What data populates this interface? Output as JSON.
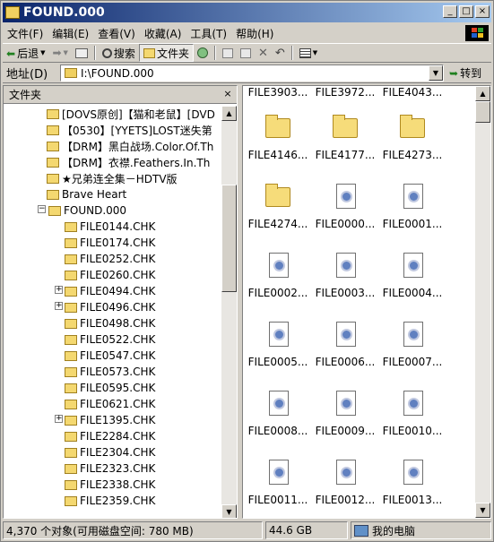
{
  "window": {
    "title": "FOUND.000",
    "min": "_",
    "max": "□",
    "close": "×"
  },
  "menu": [
    "文件(F)",
    "编辑(E)",
    "查看(V)",
    "收藏(A)",
    "工具(T)",
    "帮助(H)"
  ],
  "toolbar": {
    "back": "后退",
    "search": "搜索",
    "folders": "文件夹"
  },
  "address": {
    "label": "地址(D)",
    "value": "I:\\FOUND.000",
    "go": "转到"
  },
  "leftpane": {
    "title": "文件夹",
    "close": "×",
    "items": [
      "[DOVS原创]【猫和老鼠】[DVD",
      "【0530】[YYETS]LOST迷失第",
      "【DRM】黑白战场.Color.Of.Th",
      "【DRM】衣襟.Feathers.In.Th",
      "★兄弟连全集－HDTV版",
      "Brave Heart",
      "FOUND.000",
      "FILE0144.CHK",
      "FILE0174.CHK",
      "FILE0252.CHK",
      "FILE0260.CHK",
      "FILE0494.CHK",
      "FILE0496.CHK",
      "FILE0498.CHK",
      "FILE0522.CHK",
      "FILE0547.CHK",
      "FILE0573.CHK",
      "FILE0595.CHK",
      "FILE0621.CHK",
      "FILE1395.CHK",
      "FILE2284.CHK",
      "FILE2304.CHK",
      "FILE2323.CHK",
      "FILE2338.CHK",
      "FILE2359.CHK"
    ]
  },
  "rightpane": {
    "partial": [
      "FILE3903...",
      "FILE3972...",
      "FILE4043..."
    ],
    "items": [
      "FILE4146...",
      "FILE4177...",
      "FILE4273...",
      "FILE4274...",
      "FILE0000...",
      "FILE0001...",
      "FILE0002...",
      "FILE0003...",
      "FILE0004...",
      "FILE0005...",
      "FILE0006...",
      "FILE0007...",
      "FILE0008...",
      "FILE0009...",
      "FILE0010...",
      "FILE0011...",
      "FILE0012...",
      "FILE0013..."
    ]
  },
  "status": {
    "objects": "4,370 个对象(可用磁盘空间: 780 MB)",
    "size": "44.6 GB",
    "location": "我的电脑"
  }
}
